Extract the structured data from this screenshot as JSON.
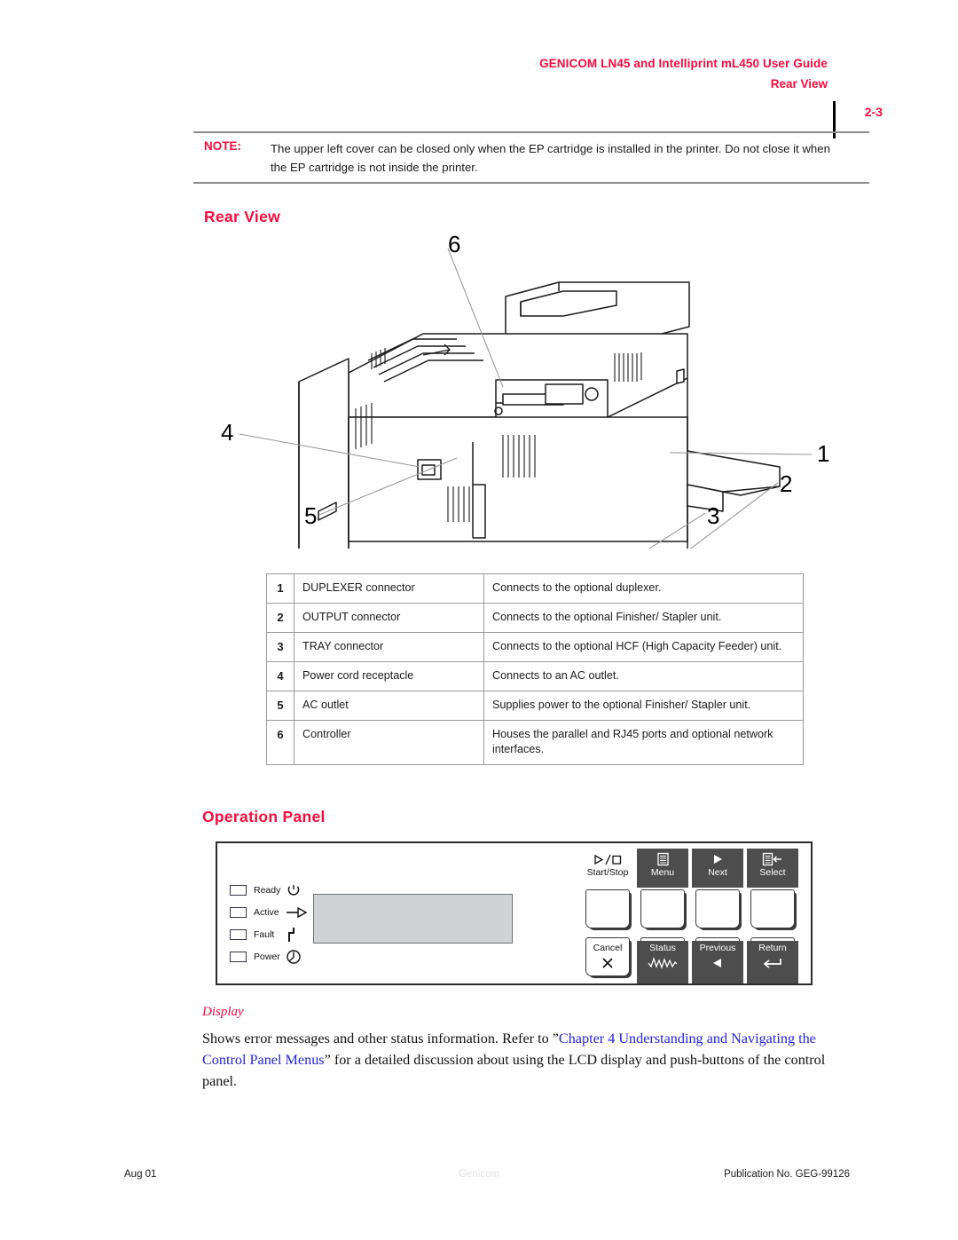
{
  "header": {
    "title": "GENICOM LN45 and Intelliprint mL450 User Guide",
    "subtitle": "Rear View",
    "page_number": "2-3"
  },
  "note": {
    "label": "NOTE:",
    "text": "The upper left cover can be closed only when the EP cartridge is installed in the printer. Do not close it when the EP cartridge is not inside the printer."
  },
  "sections": {
    "rear_view_heading": "Rear View",
    "operation_panel_heading": "Operation Panel"
  },
  "figure": {
    "alt": "rear view line drawing of printer with numbered callouts",
    "callouts": [
      "1",
      "2",
      "3",
      "4",
      "5",
      "6"
    ]
  },
  "table": {
    "rows": [
      {
        "num": "1",
        "part": "DUPLEXER connector",
        "desc": "Connects to the optional duplexer."
      },
      {
        "num": "2",
        "part": "OUTPUT connector",
        "desc": "Connects to the optional Finisher/ Stapler unit."
      },
      {
        "num": "3",
        "part": "TRAY connector",
        "desc": "Connects to the optional HCF (High Capacity Feeder) unit."
      },
      {
        "num": "4",
        "part": "Power cord receptacle",
        "desc": "Connects to an AC outlet."
      },
      {
        "num": "5",
        "part": "AC outlet",
        "desc": "Supplies power to the optional Finisher/ Stapler unit."
      },
      {
        "num": "6",
        "part": "Controller",
        "desc": "Houses the parallel and RJ45 ports and optional network interfaces."
      }
    ]
  },
  "operation_panel": {
    "leds": [
      {
        "label": "Ready",
        "icon": "ready-ring-icon"
      },
      {
        "label": "Active",
        "icon": "active-arrow-icon"
      },
      {
        "label": "Fault",
        "icon": "fault-bolt-icon"
      },
      {
        "label": "Power",
        "icon": "power-circle-icon"
      }
    ],
    "display_name": "lcd-display",
    "buttons": [
      {
        "label": "Start/Stop",
        "icon": "play-stop-icon",
        "position": "top",
        "style": "light"
      },
      {
        "label": "Menu",
        "icon": "menu-list-icon",
        "position": "top",
        "style": "dark"
      },
      {
        "label": "Next",
        "icon": "right-triangle-icon",
        "position": "top",
        "style": "dark"
      },
      {
        "label": "Select",
        "icon": "select-list-arrow-icon",
        "position": "top",
        "style": "dark"
      },
      {
        "label": "Cancel",
        "icon": "x-icon",
        "position": "bottom",
        "style": "light"
      },
      {
        "label": "Status",
        "icon": "waveform-icon",
        "position": "bottom",
        "style": "dark"
      },
      {
        "label": "Previous",
        "icon": "left-triangle-icon",
        "position": "bottom",
        "style": "dark"
      },
      {
        "label": "Return",
        "icon": "enter-arrow-icon",
        "position": "bottom",
        "style": "dark"
      }
    ]
  },
  "body": {
    "subheading": "Display",
    "text_before": "Shows error messages and other status information. Refer to ",
    "quote_open": "”",
    "link_text": "Chapter 4 Understanding and Navigating the Control Panel Menus",
    "quote_close": "”",
    "text_after": " for a detailed discussion about using the LCD display and push-buttons of the control panel."
  },
  "footer": {
    "left": "Aug 01",
    "center": "Genicom",
    "right": "Publication No. GEG-99126"
  },
  "colors": {
    "accent_red": "#FA0A3C",
    "link_blue": "#2222DD",
    "lcd_gray": "#D0D3D5",
    "button_dark": "#4D4D4D"
  }
}
